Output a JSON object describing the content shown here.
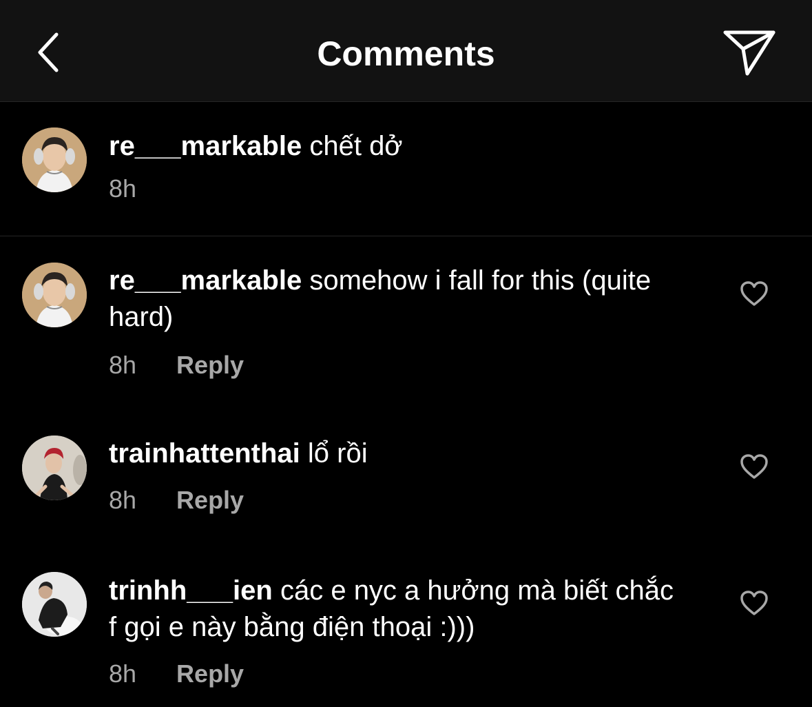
{
  "header": {
    "title": "Comments",
    "back_icon": "chevron-left-icon",
    "share_icon": "paper-plane-icon"
  },
  "caption": {
    "username": "re___markable",
    "text": "chết dở",
    "time": "8h"
  },
  "comments": [
    {
      "username": "re___markable",
      "text": "somehow i fall for this (quite hard)",
      "time": "8h",
      "reply_label": "Reply",
      "like_icon": "heart-outline-icon"
    },
    {
      "username": "trainhattenthai",
      "text": "lổ rồi",
      "time": "8h",
      "reply_label": "Reply",
      "like_icon": "heart-outline-icon"
    },
    {
      "username": "trinhh___ien",
      "text": "các e nyc a hưởng mà biết chắc f gọi e này bằng điện thoại :)))",
      "time": "8h",
      "reply_label": "Reply",
      "like_icon": "heart-outline-icon"
    }
  ],
  "colors": {
    "background": "#000000",
    "header_bg": "#121212",
    "text_primary": "#ffffff",
    "text_secondary": "#a8a8a8",
    "divider": "#262626"
  }
}
